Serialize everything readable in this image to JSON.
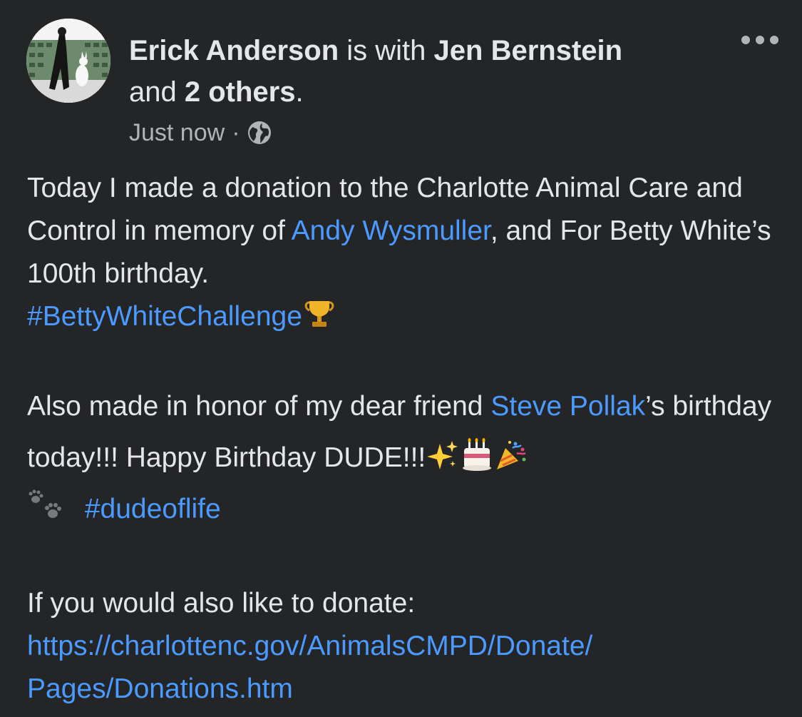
{
  "post": {
    "author": "Erick Anderson",
    "with_text": " is with ",
    "tagged": "Jen Bernstein",
    "and_text": "and ",
    "others": "2 others",
    "period": ".",
    "time": "Just now",
    "separator": "·",
    "paragraph1": {
      "text_a": "Today I made a donation to the Charlotte Animal Care and Control in memory of ",
      "mention": "Andy Wysmuller",
      "text_b": ", and For Betty White’s 100th birthday.",
      "hashtag": "#BettyWhiteChallenge"
    },
    "paragraph2": {
      "text_a": "Also made in honor of my dear friend ",
      "mention": "Steve Pollak",
      "text_b": "’s birthday today!!! Happy Birthday DUDE!!!",
      "hashtag": "#dudeoflife"
    },
    "paragraph3": {
      "text": "If you would also like to donate:",
      "url_line1": "https://charlottenc.gov/AnimalsCMPD/Donate/",
      "url_line2": "Pages/Donations.htm"
    }
  },
  "icons": {
    "more": "more-options-icon",
    "globe": "globe-icon",
    "trophy": "trophy-emoji",
    "sparkles": "sparkles-emoji",
    "cake": "birthday-cake-emoji",
    "party": "party-popper-emoji",
    "paws": "paw-prints-emoji"
  },
  "colors": {
    "background": "#242526",
    "text": "#e4e6eb",
    "secondary": "#b0b3b8",
    "link": "#4b9aff"
  }
}
